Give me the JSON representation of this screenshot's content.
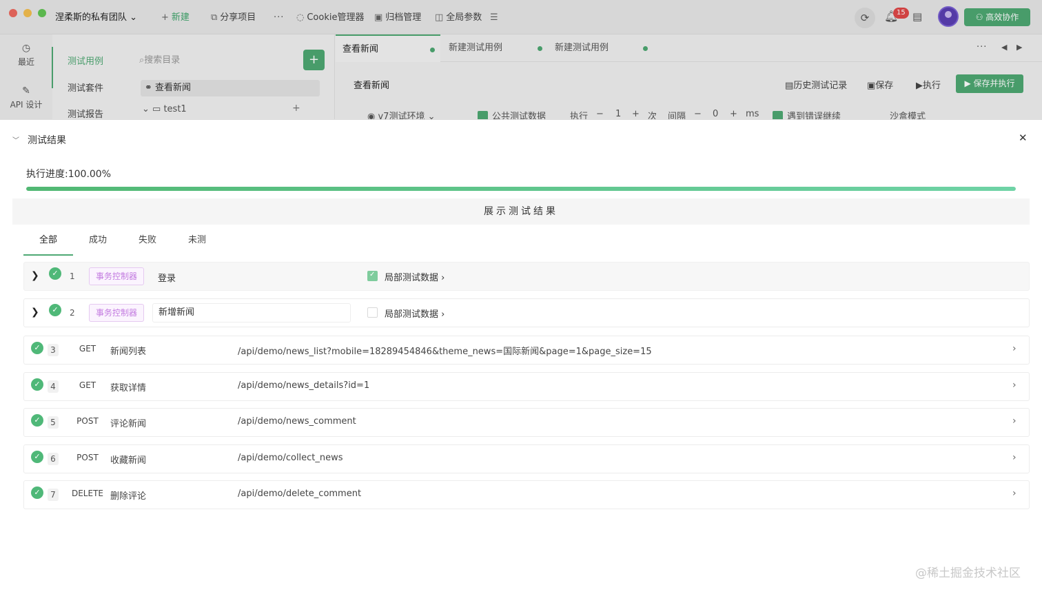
{
  "titlebar": {
    "team_name": "涅柔斯的私有团队",
    "new_label": "新建",
    "share_label": "分享项目",
    "more_label": "···",
    "cookie_label": "Cookie管理器",
    "archive_label": "归档管理",
    "global_params_label": "全局参数",
    "notification_count": "15",
    "collab_label": "高效协作"
  },
  "rail": {
    "recent_label": "最近",
    "api_label": "API 设计"
  },
  "nav": {
    "cases": "测试用例",
    "suites": "测试套件",
    "reports": "测试报告"
  },
  "tree": {
    "search_placeholder": "搜索目录",
    "items": [
      "查看新闻",
      "test1"
    ]
  },
  "workspace": {
    "tabs": [
      "查看新闻",
      "新建测试用例",
      "新建测试用例"
    ],
    "heading": "查看新闻",
    "history_label": "历史测试记录",
    "save_label": "保存",
    "run_label": "执行",
    "save_run_label": "保存并执行",
    "env": "v7测试环境",
    "public_data_label": "公共测试数据",
    "exec_label": "执行",
    "exec_count": "1",
    "times_unit": "次",
    "interval_label": "间隔",
    "interval_value": "0",
    "interval_unit": "ms",
    "continue_label": "遇到错误继续",
    "sandbox_label": "沙盒模式"
  },
  "results": {
    "title": "测试结果",
    "progress_label": "执行进度:100.00%",
    "progress_fraction": 1.0,
    "show_results_label": "展示测试结果",
    "filter_tabs": [
      "全部",
      "成功",
      "失败",
      "未测"
    ],
    "local_data_label": "局部测试数据",
    "controller_tag": "事务控制器",
    "controllers": [
      {
        "index": "1",
        "name": "登录",
        "local_data_checked": true
      },
      {
        "index": "2",
        "name": "新增新闻",
        "local_data_checked": false
      }
    ],
    "apis": [
      {
        "index": "3",
        "method": "GET",
        "name": "新闻列表",
        "url": "/api/demo/news_list?mobile=18289454846&theme_news=国际新闻&page=1&page_size=15"
      },
      {
        "index": "4",
        "method": "GET",
        "name": "获取详情",
        "url": "/api/demo/news_details?id=1"
      },
      {
        "index": "5",
        "method": "POST",
        "name": "评论新闻",
        "url": "/api/demo/news_comment"
      },
      {
        "index": "6",
        "method": "POST",
        "name": "收藏新闻",
        "url": "/api/demo/collect_news"
      },
      {
        "index": "7",
        "method": "DELETE",
        "name": "删除评论",
        "url": "/api/demo/delete_comment"
      }
    ]
  },
  "watermark": "@稀土掘金技术社区",
  "colors": {
    "accent": "#4ea873",
    "controller_tag": "#c37be0",
    "progress_start": "#51b873",
    "progress_end": "#6fd3a6"
  }
}
